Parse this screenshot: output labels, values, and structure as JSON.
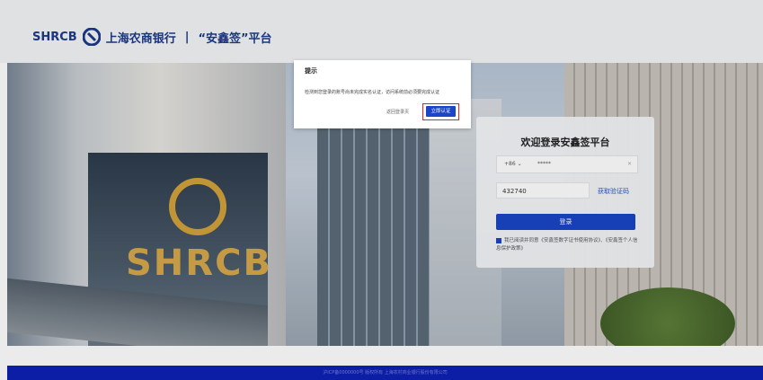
{
  "header": {
    "brand_en": "SHRCB",
    "brand_cn": "上海农商银行",
    "separator": "|",
    "platform_name": "“安鑫签”平台",
    "brand_color": "#1d3a8a"
  },
  "hero": {
    "building_sign": "SHRCB"
  },
  "dialog": {
    "title": "提示",
    "message": "检测到您登录的账号尚未完成实名认证，访问系统前必须要完成认证",
    "back_button": "返回登录页",
    "verify_button": "立即认证"
  },
  "login": {
    "title": "欢迎登录安鑫签平台",
    "country_code": "+86 ⌄",
    "phone_value": "*****",
    "clear_icon": "✕",
    "code_value": "432740",
    "get_code": "获取验证码",
    "login_button": "登录",
    "agreement_text": "我已阅读并同意《安鑫签数字证书使用协议》、《安鑫签个人信息保护政策》"
  },
  "footer": {
    "text": "沪ICP备0000000号 版权所有 上海农村商业银行股份有限公司"
  },
  "colors": {
    "accent": "#1945c6",
    "footer_bg": "#0d1ea6",
    "highlight": "#d12b2b"
  }
}
